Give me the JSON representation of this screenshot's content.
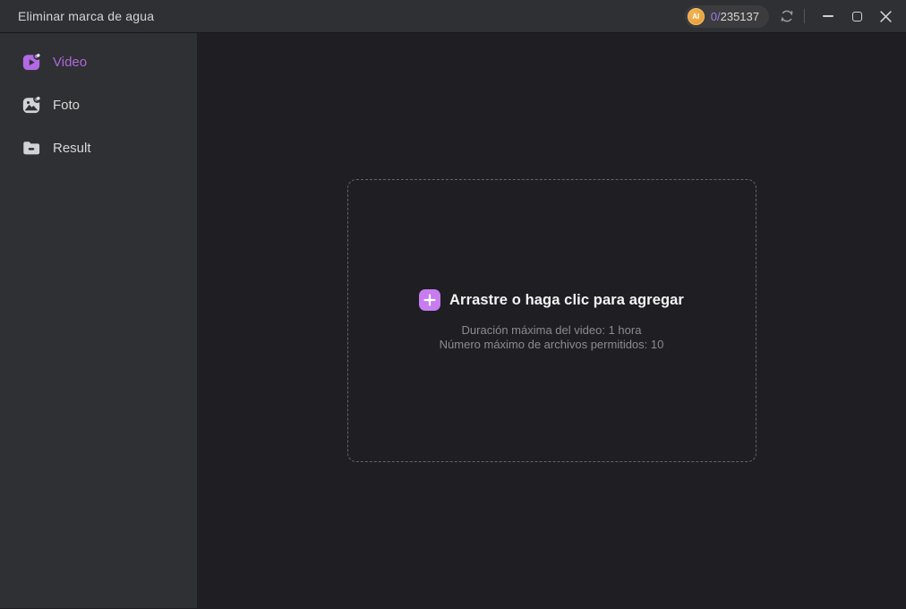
{
  "window": {
    "title": "Eliminar marca de agua",
    "credits": {
      "badge_label": "AI",
      "used": "0/",
      "total": "235137"
    }
  },
  "sidebar": {
    "items": [
      {
        "label": "Video",
        "icon": "video-erase-icon",
        "active": true
      },
      {
        "label": "Foto",
        "icon": "photo-erase-icon",
        "active": false
      },
      {
        "label": "Result",
        "icon": "result-folder-icon",
        "active": false
      }
    ]
  },
  "dropzone": {
    "title": "Arrastre o haga clic para agregar",
    "line1": "Duración máxima del video: 1 hora",
    "line2": "Número máximo de archivos permitidos: 10"
  },
  "colors": {
    "accent_purple": "#ad68de",
    "plus_button_purple": "#c77cf0",
    "coin_orange": "#e8a33c",
    "credits_used_purple": "#9d7ce4",
    "titlebar_bg": "#2f3033",
    "sidebar_bg": "#2f3033",
    "main_bg": "#1e1e23",
    "dropzone_border": "#64646c",
    "subtext_gray": "#8b8b90"
  }
}
